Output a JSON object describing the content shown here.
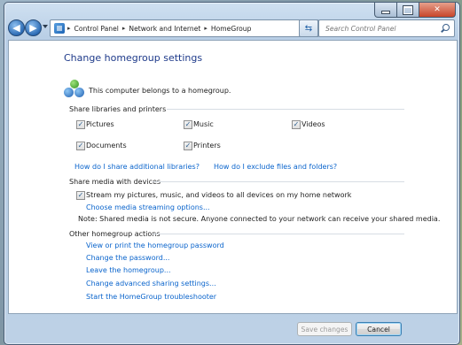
{
  "nav": {
    "breadcrumb": [
      "Control Panel",
      "Network and Internet",
      "HomeGroup"
    ],
    "search_placeholder": "Search Control Panel"
  },
  "page": {
    "title": "Change homegroup settings",
    "status": "This computer belongs to a homegroup."
  },
  "share_libraries": {
    "heading": "Share libraries and printers",
    "items": [
      {
        "label": "Pictures",
        "checked": true
      },
      {
        "label": "Music",
        "checked": true
      },
      {
        "label": "Videos",
        "checked": true
      },
      {
        "label": "Documents",
        "checked": true
      },
      {
        "label": "Printers",
        "checked": true
      }
    ],
    "link_libraries": "How do I share additional libraries?",
    "link_exclude": "How do I exclude files and folders?"
  },
  "share_media": {
    "heading": "Share media with devices",
    "stream_label": "Stream my pictures, music, and videos to all devices on my home network",
    "stream_checked": true,
    "options_link": "Choose media streaming options...",
    "note": "Note: Shared media is not secure. Anyone connected to your network can receive your shared media."
  },
  "other_actions": {
    "heading": "Other homegroup actions",
    "links": [
      "View or print the homegroup password",
      "Change the password...",
      "Leave the homegroup...",
      "Change advanced sharing settings...",
      "Start the HomeGroup troubleshooter"
    ]
  },
  "footer": {
    "save_label": "Save changes",
    "cancel_label": "Cancel"
  }
}
